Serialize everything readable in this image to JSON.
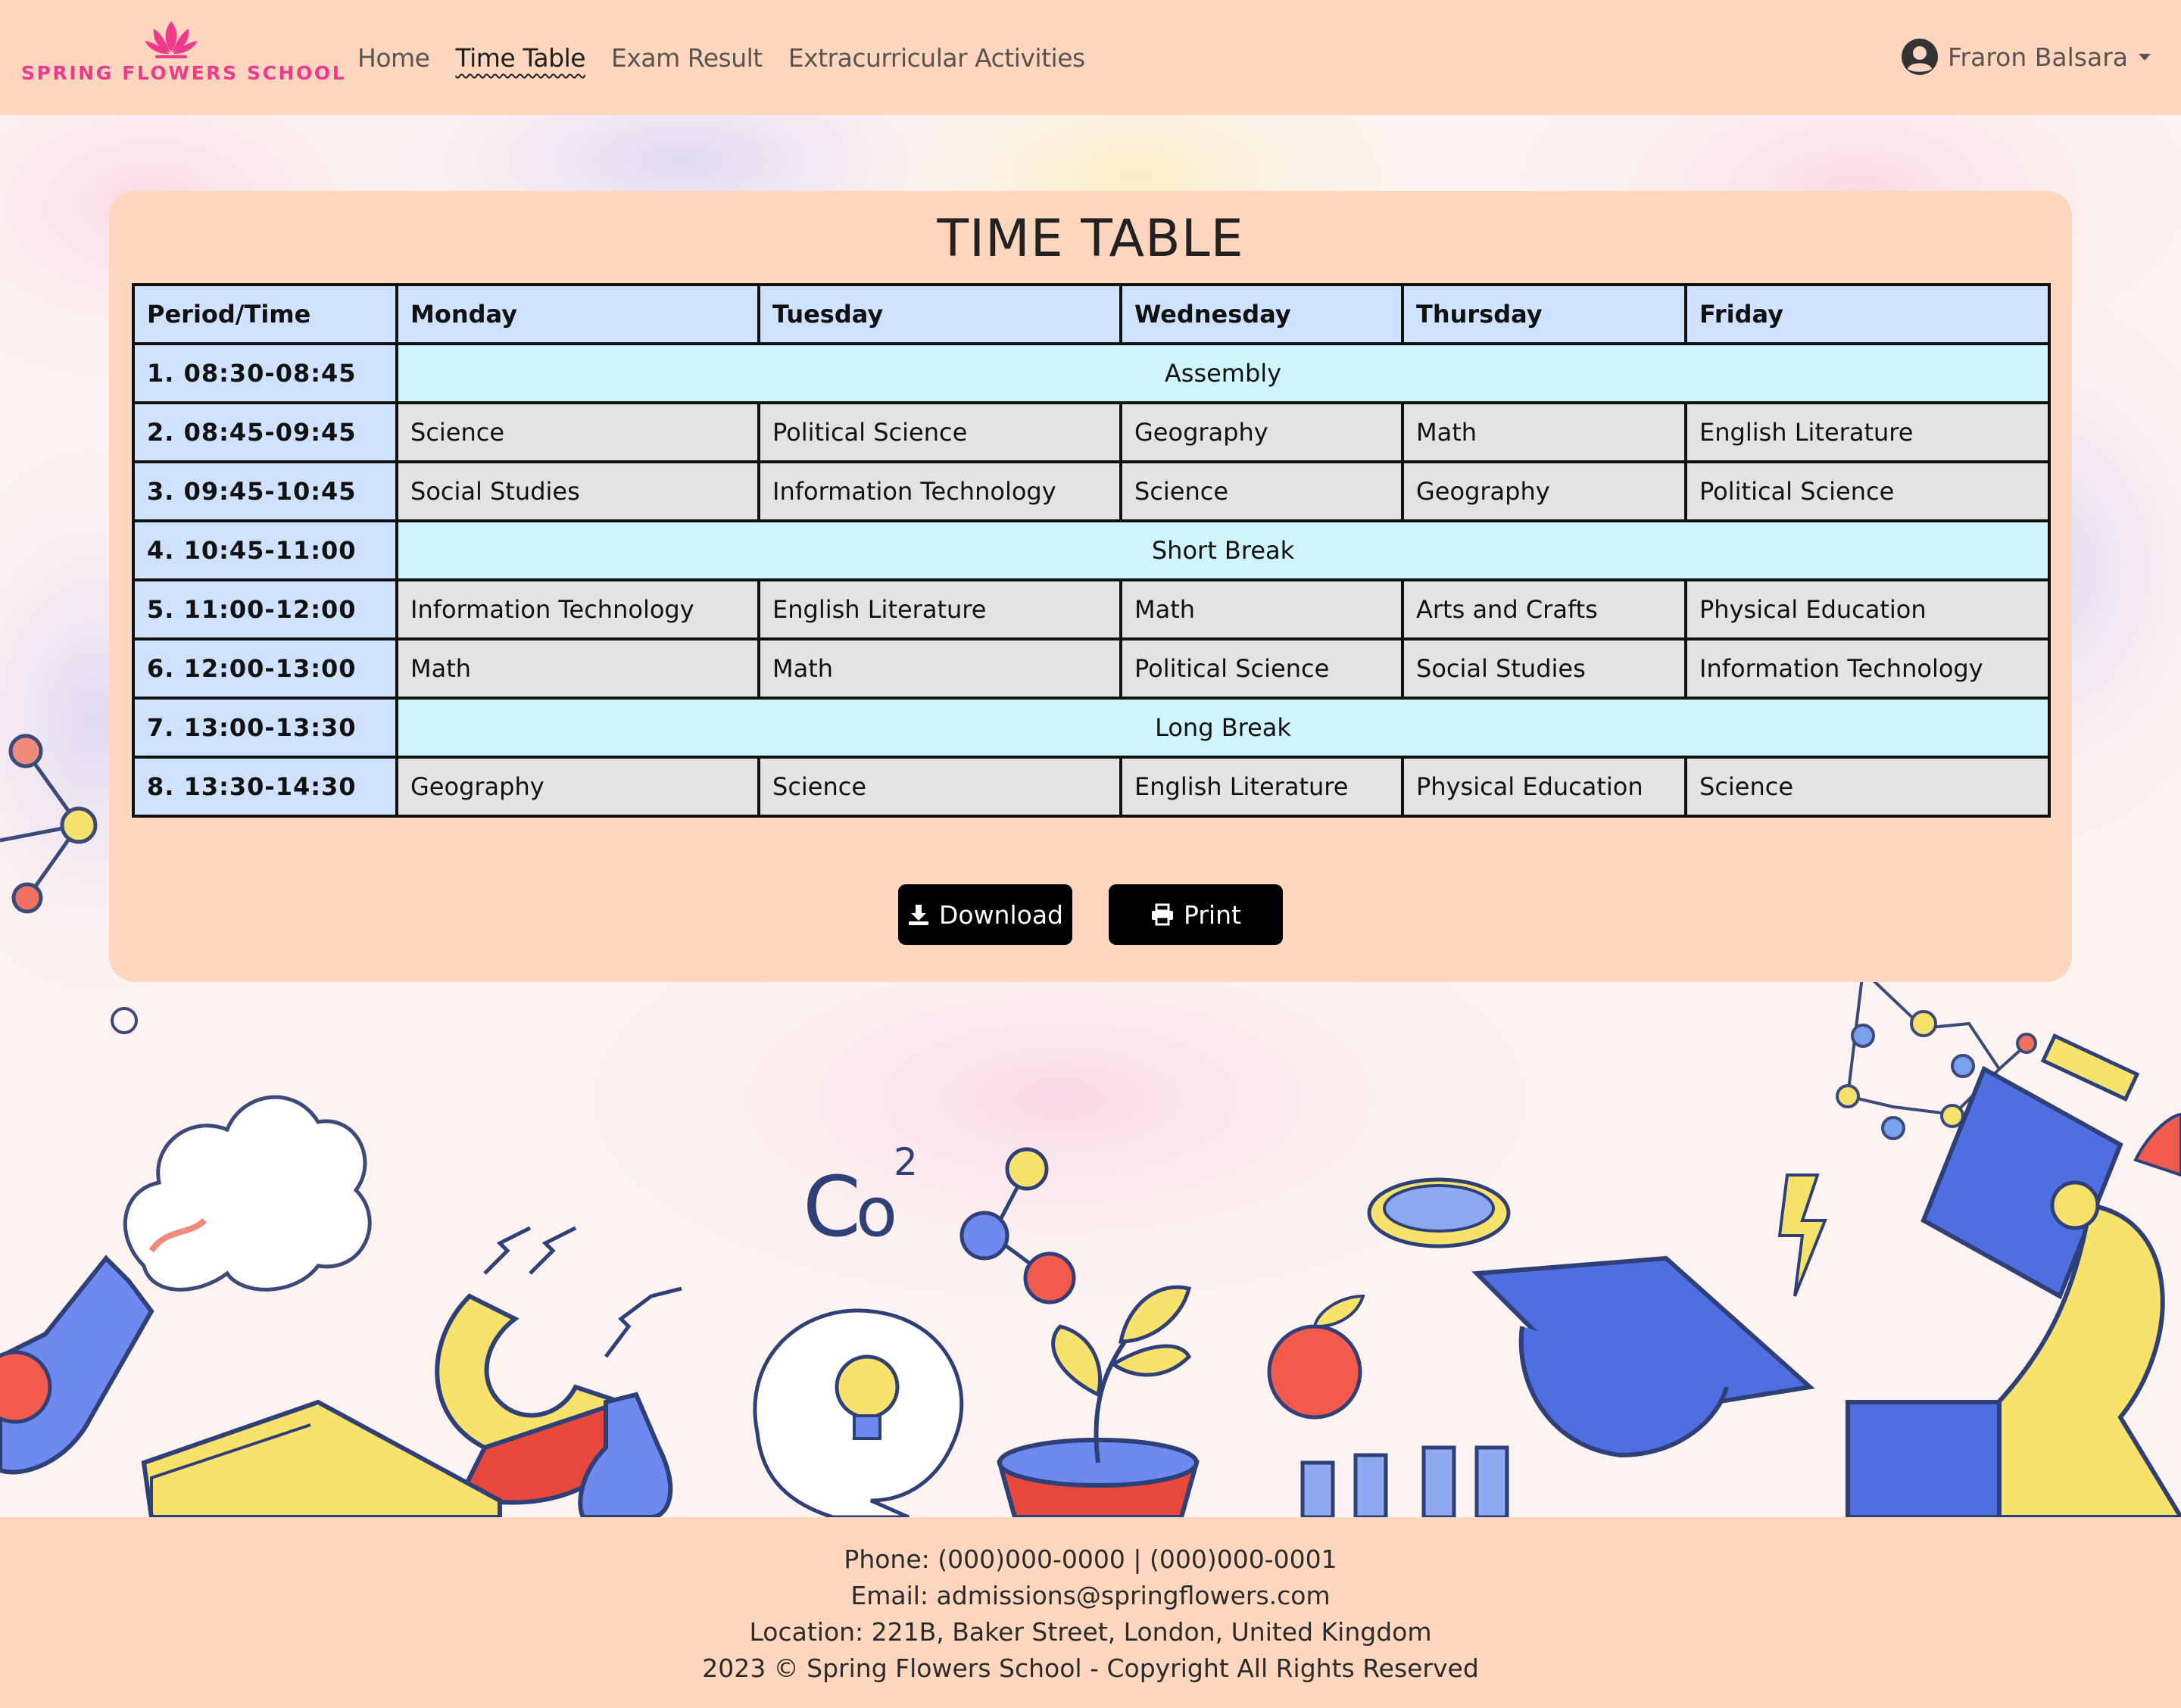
{
  "brand": {
    "name": "SPRING FLOWERS SCHOOL",
    "logo_icon": "lotus-icon",
    "accent_color": "#ee3a8c"
  },
  "nav": {
    "links": [
      {
        "label": "Home",
        "active": false
      },
      {
        "label": "Time Table",
        "active": true
      },
      {
        "label": "Exam Result",
        "active": false
      },
      {
        "label": "Extracurricular Activities",
        "active": false
      }
    ],
    "user": {
      "name": "Fraron Balsara",
      "icon": "user-circle-icon"
    }
  },
  "timetable": {
    "title": "TIME TABLE",
    "headers": [
      "Period/Time",
      "Monday",
      "Tuesday",
      "Wednesday",
      "Thursday",
      "Friday"
    ],
    "rows": [
      {
        "period": "1. 08:30-08:45",
        "break": "Assembly"
      },
      {
        "period": "2. 08:45-09:45",
        "subjects": [
          "Science",
          "Political Science",
          "Geography",
          "Math",
          "English Literature"
        ]
      },
      {
        "period": "3. 09:45-10:45",
        "subjects": [
          "Social Studies",
          "Information Technology",
          "Science",
          "Geography",
          "Political Science"
        ]
      },
      {
        "period": "4. 10:45-11:00",
        "break": "Short Break"
      },
      {
        "period": "5. 11:00-12:00",
        "subjects": [
          "Information Technology",
          "English Literature",
          "Math",
          "Arts and Crafts",
          "Physical Education"
        ]
      },
      {
        "period": "6. 12:00-13:00",
        "subjects": [
          "Math",
          "Math",
          "Political Science",
          "Social Studies",
          "Information Technology"
        ]
      },
      {
        "period": "7. 13:00-13:30",
        "break": "Long Break"
      },
      {
        "period": "8. 13:30-14:30",
        "subjects": [
          "Geography",
          "Science",
          "English Literature",
          "Physical Education",
          "Science"
        ]
      }
    ],
    "colors": {
      "header": "#cfe2ff",
      "subject": "#e2e3e5",
      "break": "#cff4fc"
    }
  },
  "actions": {
    "download": {
      "label": "Download",
      "icon": "download-icon"
    },
    "print": {
      "label": "Print",
      "icon": "print-icon"
    }
  },
  "footer": {
    "phone": "Phone: (000)000-0000 | (000)000-0001",
    "email": "Email: admissions@springflowers.com",
    "location": "Location: 221B, Baker Street, London, United Kingdom",
    "copyright": "2023 © Spring Flowers School - Copyright All Rights Reserved"
  }
}
